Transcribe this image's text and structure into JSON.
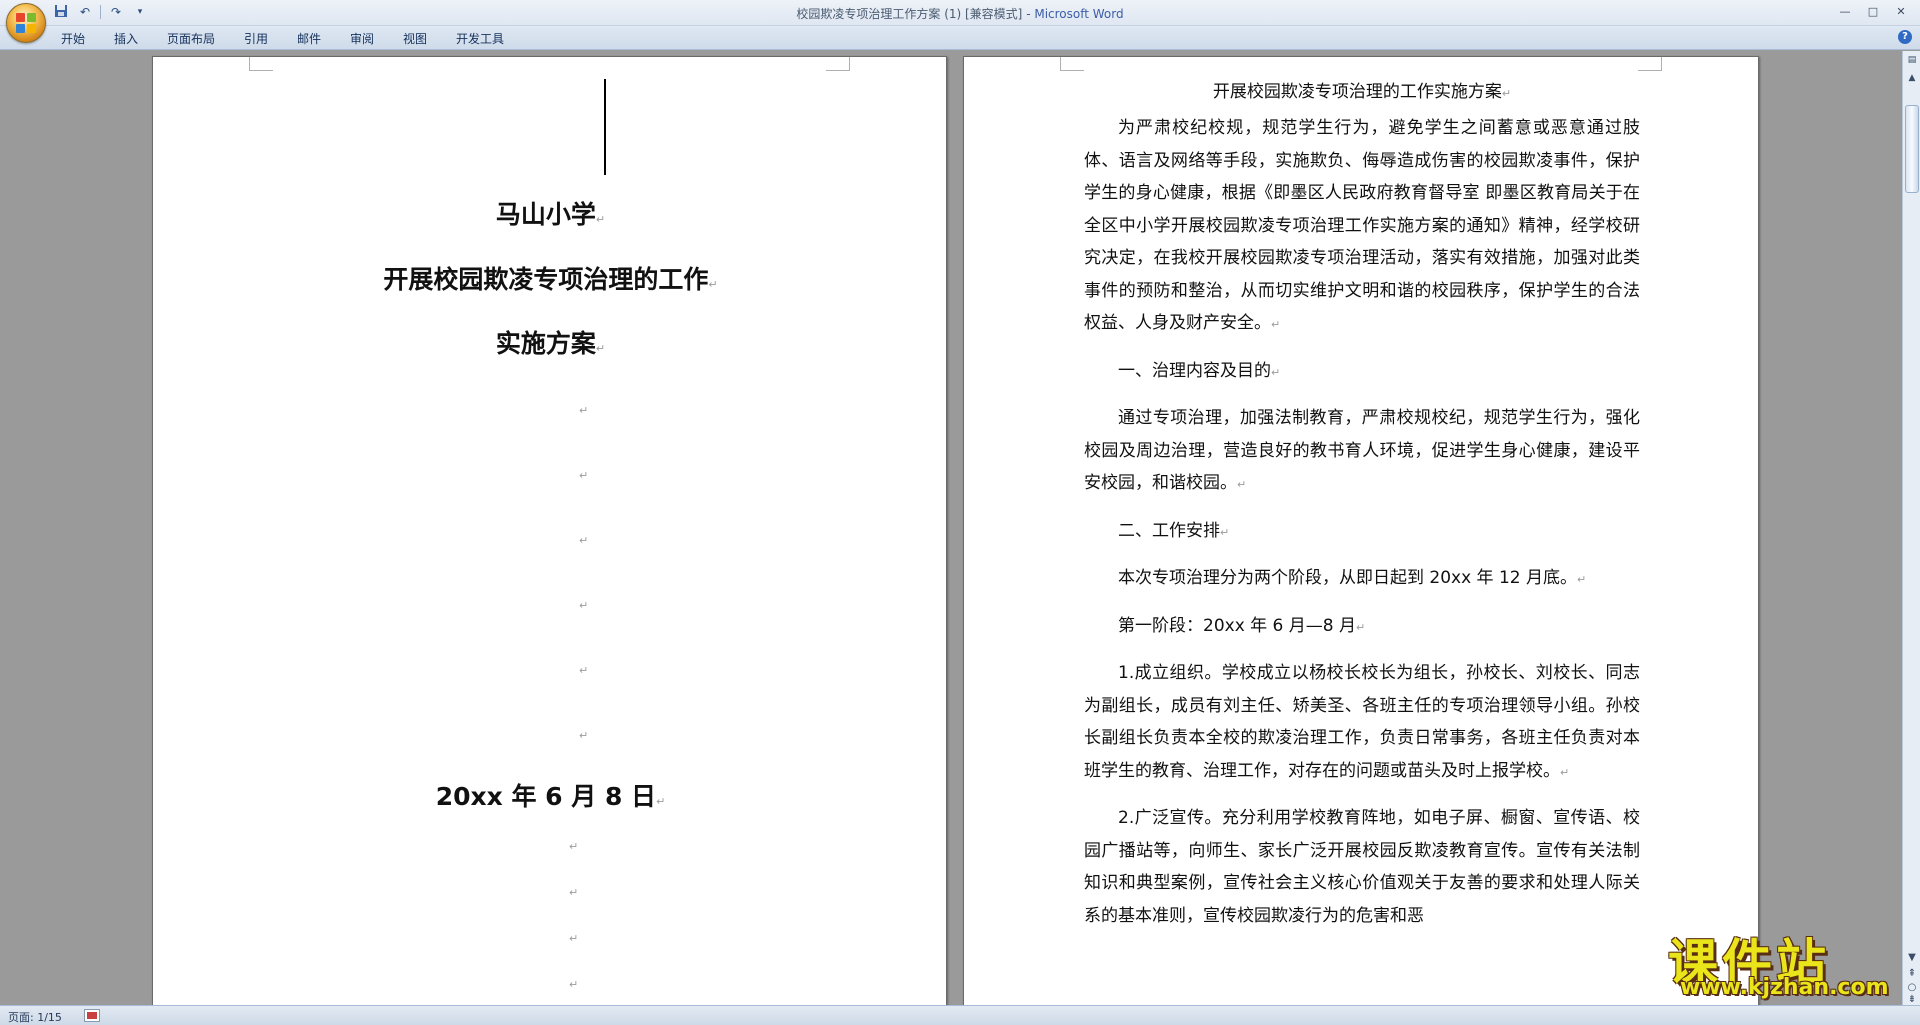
{
  "window": {
    "title": "校园欺凌专项治理工作方案 (1) [兼容模式]",
    "title_sep": " - ",
    "app_name": "Microsoft Word",
    "controls": [
      "—",
      "□",
      "✕"
    ]
  },
  "quick_access": {
    "save_icon": "save-icon",
    "undo_icon": "undo-icon",
    "redo_icon": "redo-icon",
    "customize_icon": "customize-icon"
  },
  "ribbon": {
    "tabs": [
      "开始",
      "插入",
      "页面布局",
      "引用",
      "邮件",
      "审阅",
      "视图",
      "开发工具"
    ],
    "help_label": "?"
  },
  "page1": {
    "school": "马山小学",
    "title_line1": "开展校园欺凌专项治理的工作",
    "title_line2": "实施方案",
    "date": "20xx 年 6 月 8 日",
    "para_mark": "↵"
  },
  "page2": {
    "title": "开展校园欺凌专项治理的工作实施方案",
    "paragraphs": [
      "为严肃校纪校规，规范学生行为，避免学生之间蓄意或恶意通过肢体、语言及网络等手段，实施欺负、侮辱造成伤害的校园欺凌事件，保护学生的身心健康，根据《即墨区人民政府教育督导室  即墨区教育局关于在全区中小学开展校园欺凌专项治理工作实施方案的通知》精神，经学校研究决定，在我校开展校园欺凌专项治理活动，落实有效措施，加强对此类事件的预防和整治，从而切实维护文明和谐的校园秩序，保护学生的合法权益、人身及财产安全。",
      "一、治理内容及目的",
      "通过专项治理，加强法制教育，严肃校规校纪，规范学生行为，强化校园及周边治理，营造良好的教书育人环境，促进学生身心健康，建设平安校园，和谐校园。",
      "二、工作安排",
      "本次专项治理分为两个阶段，从即日起到 20xx 年 12 月底。",
      "第一阶段：20xx 年 6 月—8 月",
      "1.成立组织。学校成立以杨校长校长为组长，孙校长、刘校长、同志为副组长，成员有刘主任、矫美圣、各班主任的专项治理领导小组。孙校长副组长负责本全校的欺凌治理工作，负责日常事务，各班主任负责对本班学生的教育、治理工作，对存在的问题或苗头及时上报学校。",
      "2.广泛宣传。充分利用学校教育阵地，如电子屏、橱窗、宣传语、校园广播站等，向师生、家长广泛开展校园反欺凌教育宣传。宣传有关法制知识和典型案例，宣传社会主义核心价值观关于友善的要求和处理人际关系的基本准则，宣传校园欺凌行为的危害和恶"
    ]
  },
  "status": {
    "page_info": "页面: 1/15"
  },
  "watermark": {
    "brand": "课件站",
    "url": "www.kjzhan.com"
  }
}
